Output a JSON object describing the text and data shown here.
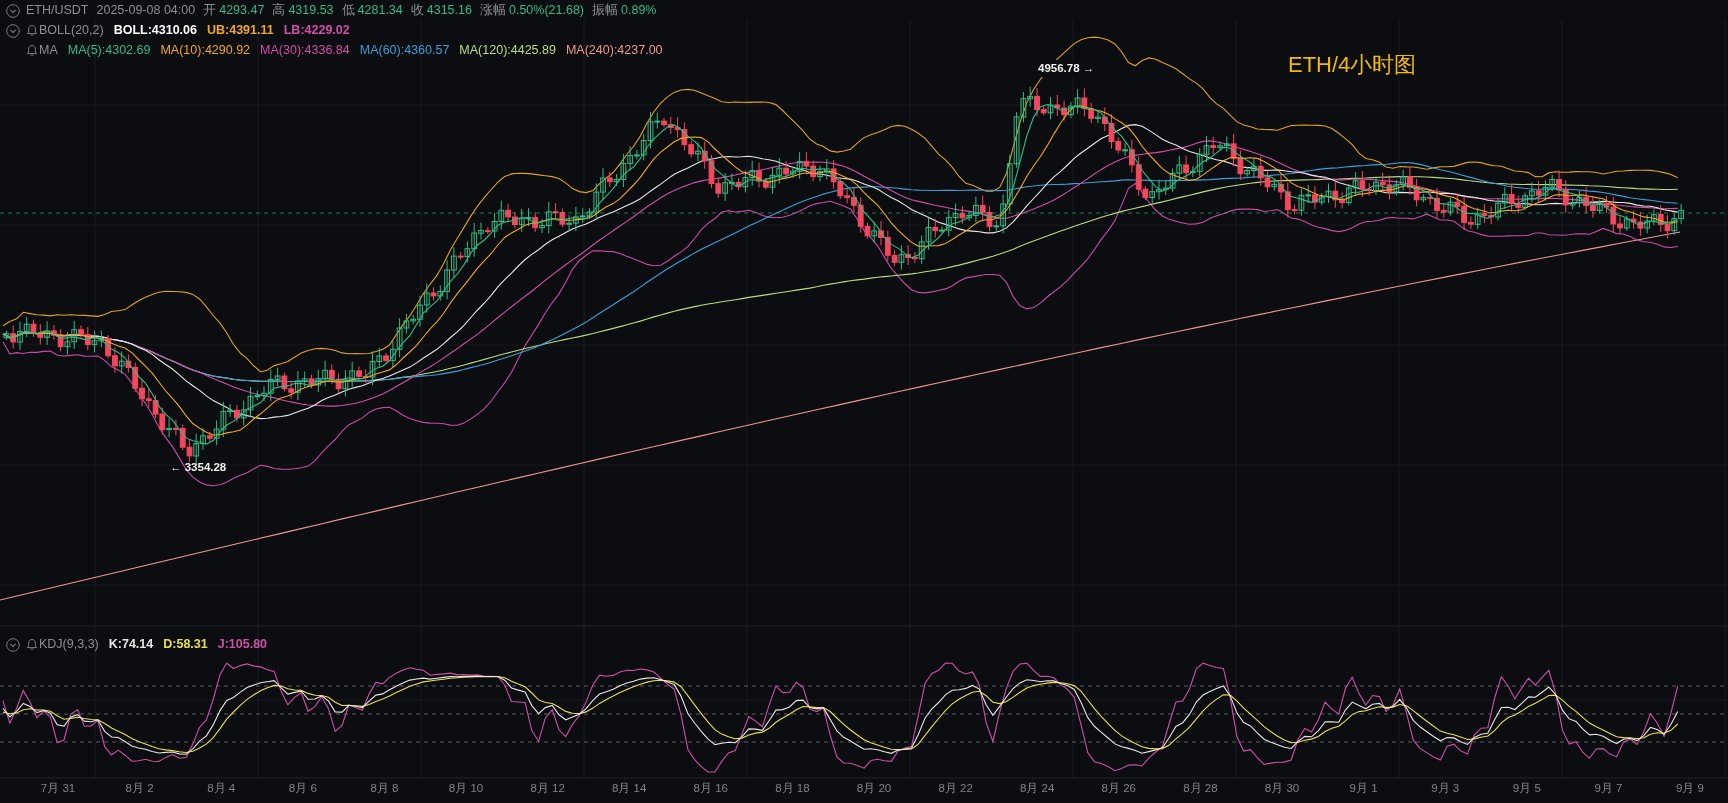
{
  "header": {
    "symbol": "ETH/USDT",
    "datetime": "2025-09-08 04:00",
    "toggle": true,
    "fields": [
      {
        "label": "开",
        "value": "4293.47"
      },
      {
        "label": "高",
        "value": "4319.53"
      },
      {
        "label": "低",
        "value": "4281.34"
      },
      {
        "label": "收",
        "value": "4315.16"
      },
      {
        "label": "涨幅",
        "value": "0.50%(21.68)"
      },
      {
        "label": "振幅",
        "value": "0.89%"
      }
    ]
  },
  "indicators": [
    {
      "name": "BOLL(20,2)",
      "toggle": true,
      "values": [
        {
          "text": "BOLL:4310.06",
          "color": "#ffffff"
        },
        {
          "text": "UB:4391.11",
          "color": "#f0a81c"
        },
        {
          "text": "LB:4229.02",
          "color": "#d04ea8"
        }
      ]
    },
    {
      "name": "MA",
      "toggle": false,
      "values": [
        {
          "text": "MA(5):4302.69",
          "color": "#2ebd85"
        },
        {
          "text": "MA(10):4290.92",
          "color": "#f0a81c"
        },
        {
          "text": "MA(30):4336.84",
          "color": "#d04ea8"
        },
        {
          "text": "MA(60):4360.57",
          "color": "#3a9fd8"
        },
        {
          "text": "MA(120):4425.89",
          "color": "#b9dc7e"
        },
        {
          "text": "MA(240):4237.00",
          "color": "#f0968f"
        }
      ]
    }
  ],
  "chart_title": "ETH/4小时图",
  "high_marker": "4956.78 →",
  "low_marker": "← 3354.28",
  "kdj": {
    "name": "KDJ(9,3,3)",
    "toggle": true,
    "values": [
      {
        "text": "K:74.14",
        "color": "#e6e6e6"
      },
      {
        "text": "D:58.31",
        "color": "#e8e04a"
      },
      {
        "text": "J:105.80",
        "color": "#d04ea8"
      }
    ]
  },
  "x_axis_labels": [
    "7月 31",
    "8月 2",
    "8月 4",
    "8月 6",
    "8月 8",
    "8月 10",
    "8月 12",
    "8月 14",
    "8月 16",
    "8月 18",
    "8月 20",
    "8月 22",
    "8月 24",
    "8月 26",
    "8月 28",
    "8月 30",
    "9月 1",
    "9月 3",
    "9月 5",
    "9月 7",
    "9月 9"
  ]
}
